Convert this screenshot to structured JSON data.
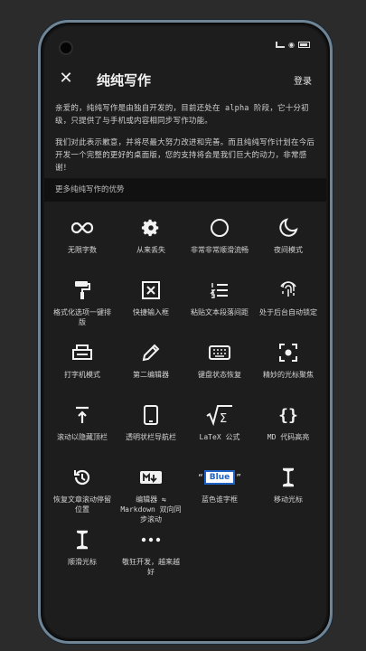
{
  "header": {
    "title": "纯纯写作",
    "login": "登录"
  },
  "description": [
    "亲爱的，纯纯写作是由独自开发的，目前还处在 alpha 阶段，它十分初级，只提供了与手机或内容相同步写作功能。",
    "我们对此表示歉意，并将尽最大努力改进和完善。而且纯纯写作计划在今后开发一个完整的更好的桌面版，您的支持将会是我们巨大的动力，非常感谢！"
  ],
  "section_title": "更多纯纯写作的优势",
  "features": [
    {
      "icon": "infinity-icon",
      "label": "无限字数"
    },
    {
      "icon": "gear-icon",
      "label": "从来丢失"
    },
    {
      "icon": "circle-icon",
      "label": "非常非常顺滑流畅"
    },
    {
      "icon": "moon-icon",
      "label": "夜间模式"
    },
    {
      "icon": "paint-roller-icon",
      "label": "格式化选项一键排版"
    },
    {
      "icon": "quick-input-icon",
      "label": "快捷输入框"
    },
    {
      "icon": "numbered-list-icon",
      "label": "粘贴文本段落间距"
    },
    {
      "icon": "fingerprint-icon",
      "label": "处于后台自动锁定"
    },
    {
      "icon": "typewriter-icon",
      "label": "打字机模式"
    },
    {
      "icon": "pencil-icon",
      "label": "第二编辑器"
    },
    {
      "icon": "keyboard-icon",
      "label": "键盘状态恢复"
    },
    {
      "icon": "focus-icon",
      "label": "精妙的光标聚焦"
    },
    {
      "icon": "scroll-top-icon",
      "label": "滚动以隐藏顶栏"
    },
    {
      "icon": "tablet-icon",
      "label": "透明状栏导航栏"
    },
    {
      "icon": "sqrt-sigma-icon",
      "label": "LaTeX 公式"
    },
    {
      "icon": "braces-icon",
      "label": "MD 代码高亮"
    },
    {
      "icon": "history-icon",
      "label": "恢复文章滚动停留位置"
    },
    {
      "icon": "markdown-icon",
      "label": "编辑器 ⇆ Markdown 双向同步滚动"
    },
    {
      "icon": "blue-tag-icon",
      "label": "蓝色谁字框",
      "tag": "Blue"
    },
    {
      "icon": "text-cursor-icon",
      "label": "移动光标"
    },
    {
      "icon": "text-cursor-icon",
      "label": "顺滑光标"
    },
    {
      "icon": "more-icon",
      "label": "敬狂开发，越来越好"
    }
  ]
}
